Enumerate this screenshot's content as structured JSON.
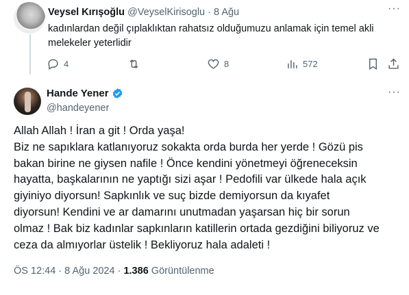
{
  "reply": {
    "name": "Veysel Kırışoğlu",
    "handle": "@VeyselKirisoglu",
    "separator": "·",
    "date": "8 Ağu",
    "text": "kadınlardan değil çıplaklıktan rahatsız olduğumuzu anlamak için temel akli melekeler yeterlidir",
    "stats": {
      "replies": "4",
      "reposts": "",
      "likes": "8",
      "views": "572"
    }
  },
  "main": {
    "name": "Hande Yener",
    "verified": true,
    "handle": "@handeyener",
    "text_lines": [
      "Allah Allah ! İran a git ! Orda yaşa!",
      "Biz ne sapıklara katlanıyoruz sokakta orda burda her yerde ! Gözü pis",
      "bakan birine ne giysen nafile ! Önce kendini yönetmeyi öğreneceksin",
      "hayatta, başkalarının ne yaptığı sizi aşar ! Pedofili var ülkede hala açık",
      "giyiniyo diyorsun!  Sapkınlık ve suç bizde demiyorsun da kıyafet",
      "diyorsun! Kendini ve ar damarını unutmadan yaşarsan hiç bir sorun",
      "olmaz ! Bak biz kadınlar sapkınların katillerin ortada gezdiğini biliyoruz ve",
      "ceza da almıyorlar üstelik !  Bekliyoruz hala adaleti !"
    ],
    "time": "ÖS 12:44",
    "separator": "·",
    "date": "8 Ağu 2024",
    "views_count": "1.386",
    "views_label": "Görüntülenme"
  },
  "colors": {
    "verified": "#1d9bf0",
    "muted": "#536471",
    "text": "#0f1419"
  },
  "icons": [
    "more-icon",
    "reply-icon",
    "repost-icon",
    "like-icon",
    "views-icon",
    "bookmark-icon",
    "share-icon",
    "verified-badge-icon"
  ]
}
